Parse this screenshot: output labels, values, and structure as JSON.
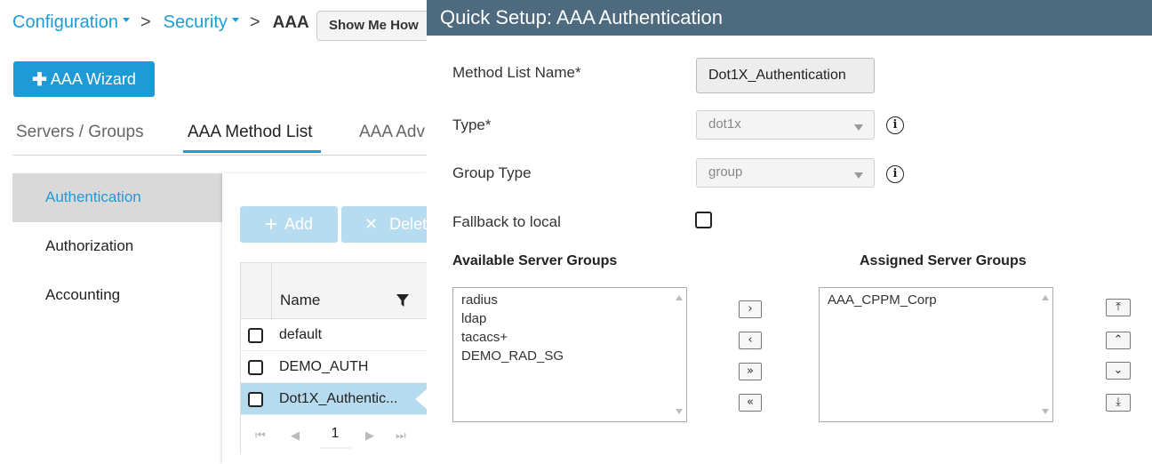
{
  "breadcrumb": {
    "items": [
      "Configuration",
      "Security"
    ],
    "separator": ">",
    "current": "AAA",
    "show_me_how": "Show Me How"
  },
  "wizard_button": {
    "icon": "plus-icon",
    "label": "AAA Wizard"
  },
  "tabs": [
    {
      "label": "Servers / Groups",
      "active": false
    },
    {
      "label": "AAA Method List",
      "active": true
    },
    {
      "label": "AAA Adv",
      "active": false
    }
  ],
  "left_nav": {
    "items": [
      {
        "label": "Authentication",
        "active": true
      },
      {
        "label": "Authorization",
        "active": false
      },
      {
        "label": "Accounting",
        "active": false
      }
    ]
  },
  "toolbar": {
    "add_label": "Add",
    "delete_label": "Delet"
  },
  "grid": {
    "column_name": "Name",
    "rows": [
      {
        "name": "default",
        "selected": false
      },
      {
        "name": "DEMO_AUTH",
        "selected": false
      },
      {
        "name": "Dot1X_Authentic...",
        "selected": true
      }
    ],
    "pager": {
      "first": "⏮",
      "prev": "◀",
      "page": "1",
      "next": "▶",
      "last": "⏭"
    }
  },
  "modal": {
    "title": "Quick Setup: AAA Authentication",
    "method_list_name_label": "Method List Name*",
    "method_list_name_value": "Dot1X_Authentication",
    "type_label": "Type*",
    "type_value": "dot1x",
    "group_type_label": "Group Type",
    "group_type_value": "group",
    "fallback_label": "Fallback to local",
    "fallback_checked": false,
    "available_label": "Available Server Groups",
    "assigned_label": "Assigned Server Groups",
    "available_groups": [
      "radius",
      "ldap",
      "tacacs+",
      "DEMO_RAD_SG"
    ],
    "assigned_groups": [
      "AAA_CPPM_Corp"
    ],
    "move_buttons": {
      "right": "›",
      "left": "‹",
      "all_right": "»",
      "all_left": "«"
    },
    "order_buttons": {
      "top": "⤒",
      "up": "⌃",
      "down": "⌄",
      "bottom": "⤓"
    }
  },
  "colors": {
    "accent": "#1e9bd7",
    "modal_header": "#4e6a7f",
    "selected_row": "#b6daee",
    "disabled_button": "#b8dcef"
  }
}
